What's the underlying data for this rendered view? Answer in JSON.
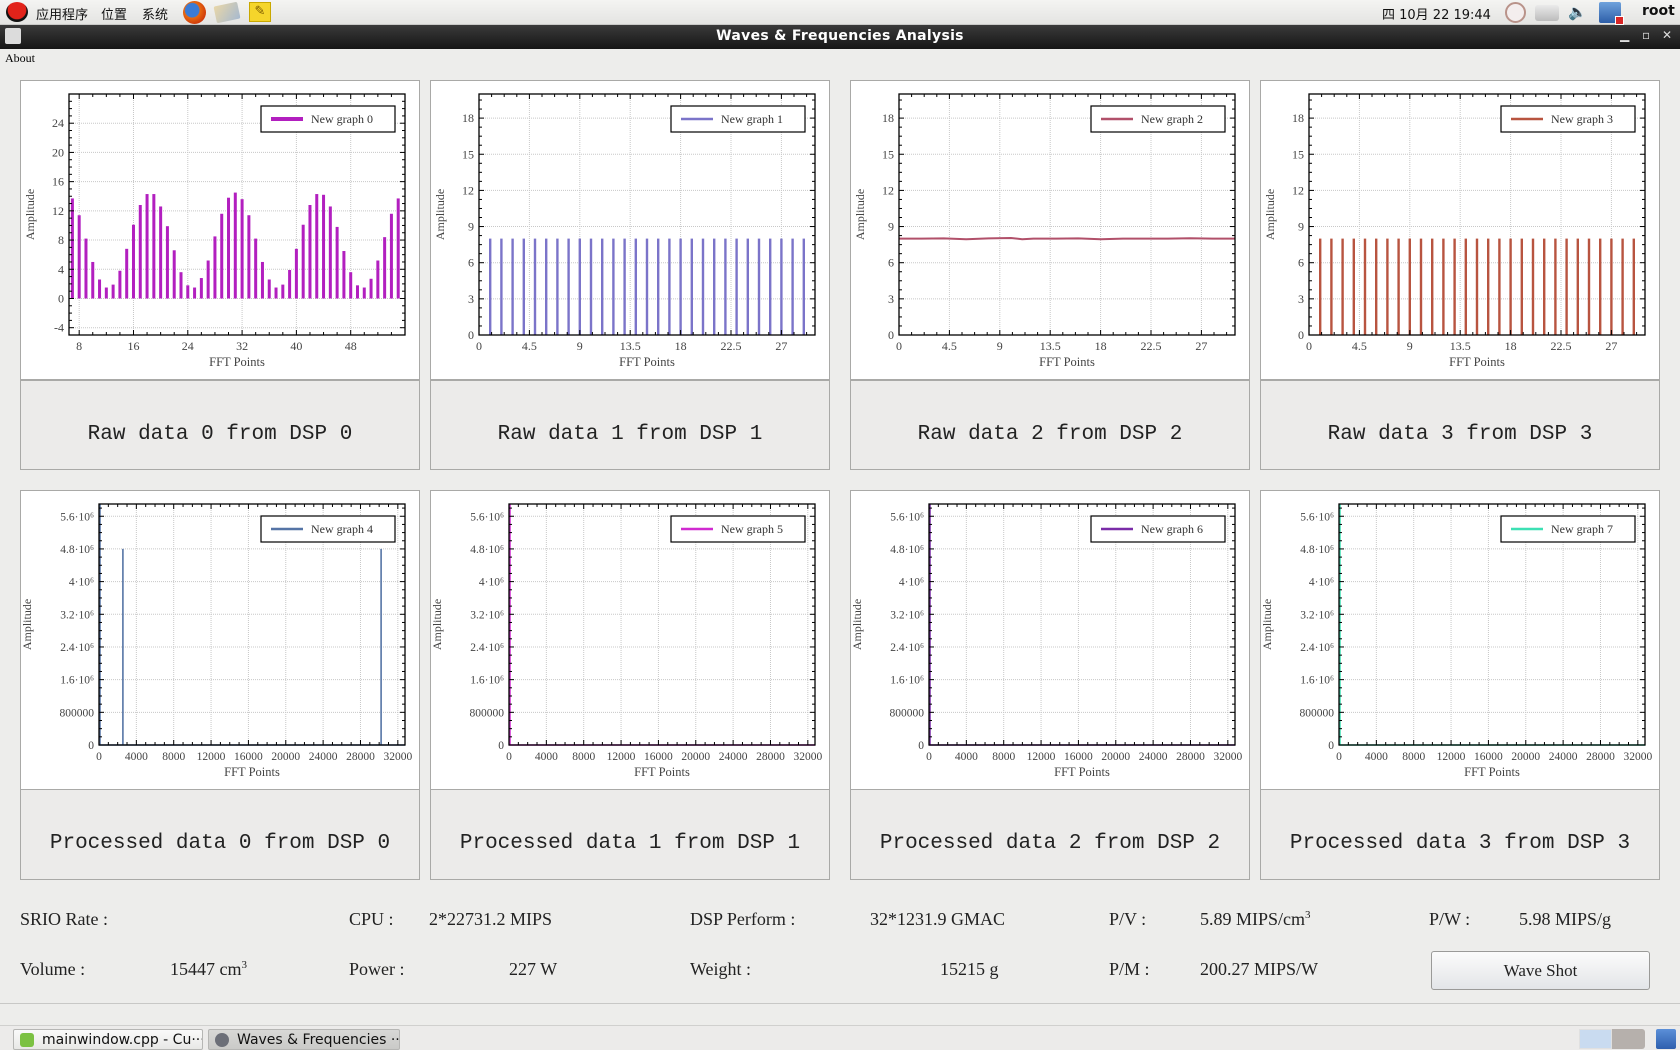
{
  "topbar": {
    "menus": [
      "应用程序",
      "位置",
      "系统"
    ],
    "clock": "四 10月 22 19:44",
    "user": "root",
    "launchers": [
      "firefox-icon",
      "file-manager-icon",
      "text-editor-icon"
    ],
    "tray_icons": [
      "gauge-icon",
      "keyboard-icon",
      "volume-icon",
      "network-disconnected-icon"
    ]
  },
  "window": {
    "title": "Waves & Frequencies Analysis",
    "controls": {
      "minimize": "▁",
      "maximize": "▫",
      "close": "✕"
    }
  },
  "menubar": {
    "about": "About"
  },
  "charts": {
    "raw": [
      {
        "caption": "Raw data 0 from DSP 0",
        "legend": "New graph 0",
        "color": "#b21fbf"
      },
      {
        "caption": "Raw data 1 from DSP 1",
        "legend": "New graph 1",
        "color": "#7b74c9"
      },
      {
        "caption": "Raw data 2 from DSP 2",
        "legend": "New graph 2",
        "color": "#b1506a"
      },
      {
        "caption": "Raw data 3 from DSP 3",
        "legend": "New graph 3",
        "color": "#b85440"
      }
    ],
    "processed": [
      {
        "caption": "Processed data 0 from DSP 0",
        "legend": "New graph 4",
        "color": "#5574a6"
      },
      {
        "caption": "Processed data 1 from DSP 1",
        "legend": "New graph 5",
        "color": "#d02ad0"
      },
      {
        "caption": "Processed data 2 from DSP 2",
        "legend": "New graph 6",
        "color": "#7a2ca8"
      },
      {
        "caption": "Processed data 3 from DSP 3",
        "legend": "New graph 7",
        "color": "#3de0b4"
      }
    ]
  },
  "chart_data": [
    {
      "type": "bar",
      "title": "",
      "legend": "New graph 0",
      "legend_position": "top-right",
      "xlabel": "FFT Points",
      "ylabel": "Amplitude",
      "xlim": [
        6.5,
        56
      ],
      "ylim": [
        -5,
        28
      ],
      "grid": true,
      "xticks": [
        8,
        16,
        24,
        32,
        40,
        48
      ],
      "yticks": [
        -4,
        0,
        4,
        8,
        12,
        16,
        20,
        24
      ],
      "x": [
        7,
        8,
        9,
        10,
        11,
        12,
        13,
        14,
        15,
        16,
        17,
        18,
        19,
        20,
        21,
        22,
        23,
        24,
        25,
        26,
        27,
        28,
        29,
        30,
        31,
        32,
        33,
        34,
        35,
        36,
        37,
        38,
        39,
        40,
        41,
        42,
        43,
        44,
        45,
        46,
        47,
        48,
        49,
        50,
        51,
        52,
        53,
        54,
        55
      ],
      "values": [
        13.7,
        11.4,
        8.2,
        5.0,
        2.6,
        1.5,
        1.9,
        3.8,
        6.8,
        10.1,
        12.8,
        14.3,
        14.3,
        12.6,
        9.9,
        6.6,
        3.6,
        1.8,
        1.5,
        2.8,
        5.2,
        8.5,
        11.6,
        13.8,
        14.5,
        13.6,
        11.4,
        8.2,
        5.0,
        2.6,
        1.5,
        1.9,
        3.9,
        6.8,
        10.1,
        12.8,
        14.3,
        14.2,
        12.6,
        9.8,
        6.5,
        3.6,
        1.8,
        1.5,
        2.7,
        5.2,
        8.4,
        11.6,
        13.7
      ]
    },
    {
      "type": "bar",
      "title": "",
      "legend": "New graph 1",
      "legend_position": "top-right",
      "xlabel": "FFT Points",
      "ylabel": "Amplitude",
      "xlim": [
        0,
        30
      ],
      "ylim": [
        0,
        20
      ],
      "grid": true,
      "xticks": [
        0,
        4.5,
        9,
        13.5,
        18,
        22.5,
        27
      ],
      "yticks": [
        0,
        3,
        6,
        9,
        12,
        15,
        18
      ],
      "x": [
        1,
        2,
        3,
        4,
        5,
        6,
        7,
        8,
        9,
        10,
        11,
        12,
        13,
        14,
        15,
        16,
        17,
        18,
        19,
        20,
        21,
        22,
        23,
        24,
        25,
        26,
        27,
        28,
        29
      ],
      "values": [
        8,
        8,
        8,
        8,
        8,
        8,
        8,
        8,
        8,
        8,
        8,
        8,
        8,
        8,
        8,
        8,
        8,
        8,
        8,
        8,
        8,
        8,
        8,
        8,
        8,
        8,
        8,
        8,
        8
      ]
    },
    {
      "type": "line",
      "title": "",
      "legend": "New graph 2",
      "legend_position": "top-right",
      "xlabel": "FFT Points",
      "ylabel": "Amplitude",
      "xlim": [
        0,
        30
      ],
      "ylim": [
        0,
        20
      ],
      "grid": true,
      "xticks": [
        0,
        4.5,
        9,
        13.5,
        18,
        22.5,
        27
      ],
      "yticks": [
        0,
        3,
        6,
        9,
        12,
        15,
        18
      ],
      "x": [
        0,
        2,
        4,
        6,
        8,
        10,
        11,
        12,
        14,
        16,
        18,
        20,
        22,
        24,
        26,
        28,
        30
      ],
      "values": [
        8.0,
        8.0,
        8.02,
        7.95,
        8.02,
        8.05,
        7.95,
        8.0,
        8.0,
        8.02,
        7.95,
        8.0,
        8.0,
        8.0,
        8.03,
        8.0,
        8.0
      ]
    },
    {
      "type": "bar",
      "title": "",
      "legend": "New graph 3",
      "legend_position": "top-right",
      "xlabel": "FFT Points",
      "ylabel": "Amplitude",
      "xlim": [
        0,
        30
      ],
      "ylim": [
        0,
        20
      ],
      "grid": true,
      "xticks": [
        0,
        4.5,
        9,
        13.5,
        18,
        22.5,
        27
      ],
      "yticks": [
        0,
        3,
        6,
        9,
        12,
        15,
        18
      ],
      "x": [
        1,
        2,
        3,
        4,
        5,
        6,
        7,
        8,
        9,
        10,
        11,
        12,
        13,
        14,
        15,
        16,
        17,
        18,
        19,
        20,
        21,
        22,
        23,
        24,
        25,
        26,
        27,
        28,
        29
      ],
      "values": [
        8,
        8,
        8,
        8,
        8,
        8,
        8,
        8,
        8,
        8,
        8,
        8,
        8,
        8,
        8,
        8,
        8,
        8,
        8,
        8,
        8,
        8,
        8,
        8,
        8,
        8,
        8,
        8,
        8
      ]
    },
    {
      "type": "line",
      "title": "",
      "legend": "New graph 4",
      "legend_position": "top-right",
      "xlabel": "FFT Points",
      "ylabel": "Amplitude",
      "xlim": [
        0,
        32768
      ],
      "ylim": [
        0,
        5900000
      ],
      "grid": true,
      "xticks": [
        0,
        4000,
        8000,
        12000,
        16000,
        20000,
        24000,
        28000,
        32000
      ],
      "yticks": [
        0,
        800000,
        1600000,
        2400000,
        3200000,
        4000000,
        4800000,
        5600000
      ],
      "ytick_labels": [
        "0",
        "800000",
        "1.6·10⁶",
        "2.4·10⁶",
        "3.2·10⁶",
        "4·10⁶",
        "4.8·10⁶",
        "5.6·10⁶"
      ],
      "x": [
        0,
        2560,
        2560,
        2560,
        30208,
        30208,
        30208,
        32768
      ],
      "values": [
        0,
        0,
        4800000,
        0,
        0,
        4800000,
        0,
        0
      ]
    },
    {
      "type": "line",
      "title": "",
      "legend": "New graph 5",
      "legend_position": "top-right",
      "xlabel": "FFT Points",
      "ylabel": "Amplitude",
      "xlim": [
        0,
        32768
      ],
      "ylim": [
        0,
        5900000
      ],
      "grid": true,
      "xticks": [
        0,
        4000,
        8000,
        12000,
        16000,
        20000,
        24000,
        28000,
        32000
      ],
      "yticks": [
        0,
        800000,
        1600000,
        2400000,
        3200000,
        4000000,
        4800000,
        5600000
      ],
      "ytick_labels": [
        "0",
        "800000",
        "1.6·10⁶",
        "2.4·10⁶",
        "3.2·10⁶",
        "4·10⁶",
        "4.8·10⁶",
        "5.6·10⁶"
      ],
      "x": [
        0,
        32768
      ],
      "values": [
        0,
        0
      ]
    },
    {
      "type": "line",
      "title": "",
      "legend": "New graph 6",
      "legend_position": "top-right",
      "xlabel": "FFT Points",
      "ylabel": "Amplitude",
      "xlim": [
        0,
        32768
      ],
      "ylim": [
        0,
        5900000
      ],
      "grid": true,
      "xticks": [
        0,
        4000,
        8000,
        12000,
        16000,
        20000,
        24000,
        28000,
        32000
      ],
      "yticks": [
        0,
        800000,
        1600000,
        2400000,
        3200000,
        4000000,
        4800000,
        5600000
      ],
      "ytick_labels": [
        "0",
        "800000",
        "1.6·10⁶",
        "2.4·10⁶",
        "3.2·10⁶",
        "4·10⁶",
        "4.8·10⁶",
        "5.6·10⁶"
      ],
      "x": [
        0,
        32768
      ],
      "values": [
        0,
        0
      ]
    },
    {
      "type": "line",
      "title": "",
      "legend": "New graph 7",
      "legend_position": "top-right",
      "xlabel": "FFT Points",
      "ylabel": "Amplitude",
      "xlim": [
        0,
        32768
      ],
      "ylim": [
        0,
        5900000
      ],
      "grid": true,
      "xticks": [
        0,
        4000,
        8000,
        12000,
        16000,
        20000,
        24000,
        28000,
        32000
      ],
      "yticks": [
        0,
        800000,
        1600000,
        2400000,
        3200000,
        4000000,
        4800000,
        5600000
      ],
      "ytick_labels": [
        "0",
        "800000",
        "1.6·10⁶",
        "2.4·10⁶",
        "3.2·10⁶",
        "4·10⁶",
        "4.8·10⁶",
        "5.6·10⁶"
      ],
      "x": [
        0,
        32768
      ],
      "values": [
        0,
        0
      ]
    }
  ],
  "stats": {
    "srio_label": "SRIO Rate :",
    "srio_value": "",
    "cpu_label": "CPU :",
    "cpu_value": "2*22731.2 MIPS",
    "dsp_label": "DSP Perform :",
    "dsp_value": "32*1231.9 GMAC",
    "pv_label": "P/V :",
    "pv_value": "5.89 MIPS/cm",
    "pv_sup": "3",
    "pw_label": "P/W :",
    "pw_value": "5.98 MIPS/g",
    "volume_label": "Volume :",
    "volume_value": "15447 cm",
    "volume_sup": "3",
    "power_label": "Power :",
    "power_value": "227 W",
    "weight_label": "Weight :",
    "weight_value": "15215 g",
    "pm_label": "P/M :",
    "pm_value": "200.27 MIPS/W"
  },
  "buttons": {
    "wave_shot": "Wave Shot"
  },
  "taskbar": {
    "tasks": [
      {
        "label": "mainwindow.cpp - Cu···",
        "active": false
      },
      {
        "label": "Waves & Frequencies ···",
        "active": true
      }
    ]
  }
}
